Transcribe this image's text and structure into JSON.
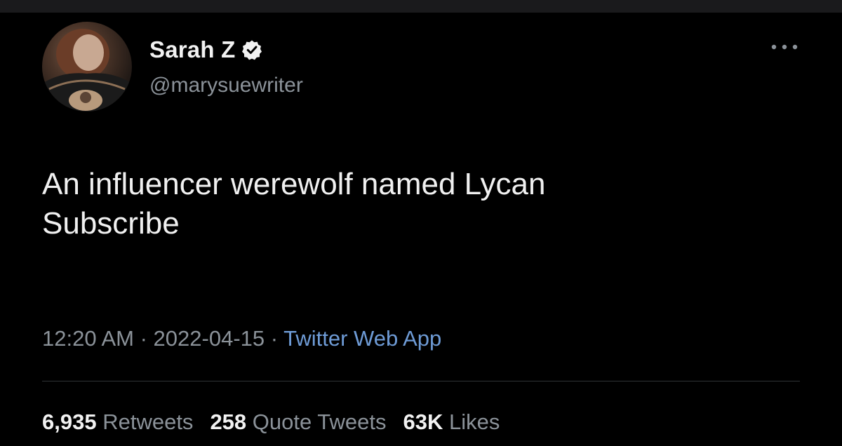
{
  "colors": {
    "background": "#000000",
    "text_primary": "#f0f0f0",
    "text_secondary": "#8b9299",
    "link": "#6e9bd6",
    "divider": "#2f3336"
  },
  "author": {
    "display_name": "Sarah Z",
    "handle": "@marysuewriter",
    "verified": true,
    "avatar_icon": "profile-photo",
    "verified_icon": "verified-badge-icon"
  },
  "more_icon": "more-options-icon",
  "tweet": {
    "text_lines": [
      "An influencer werewolf named Lycan",
      "Subscribe"
    ]
  },
  "meta": {
    "time": "12:20 AM",
    "separator": " · ",
    "date": "2022-04-15",
    "source": "Twitter Web App"
  },
  "stats": {
    "retweets_count": "6,935",
    "retweets_label": "Retweets",
    "quote_count": "258",
    "quote_label": "Quote Tweets",
    "likes_count": "63K",
    "likes_label": "Likes"
  }
}
